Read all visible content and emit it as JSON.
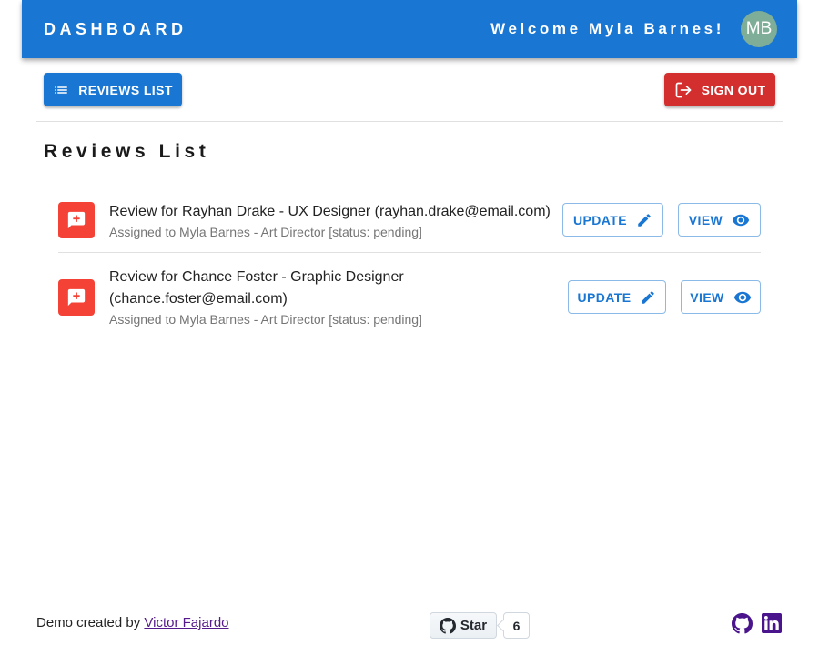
{
  "header": {
    "title": "DASHBOARD",
    "welcome": "Welcome Myla Barnes!",
    "avatar_initials": "MB",
    "color": "#1976d2"
  },
  "toolbar": {
    "reviews_list_label": "REVIEWS LIST",
    "sign_out_label": "SIGN OUT"
  },
  "main": {
    "title": "Reviews List",
    "reviews": [
      {
        "primary": "Review for Rayhan Drake - UX Designer (rayhan.drake@email.com)",
        "secondary": "Assigned to Myla Barnes - Art Director [status: pending]",
        "update_label": "UPDATE",
        "view_label": "VIEW"
      },
      {
        "primary": "Review for Chance Foster - Graphic Designer (chance.foster@email.com)",
        "secondary": "Assigned to Myla Barnes - Art Director [status: pending]",
        "update_label": "UPDATE",
        "view_label": "VIEW"
      }
    ]
  },
  "footer": {
    "credit_prefix": "Demo created by",
    "credit_link": "Victor Fajardo",
    "star_label": "Star",
    "star_count": "6"
  },
  "icons": {
    "list": "list-icon",
    "logout": "logout-icon",
    "review": "rate-review-icon",
    "edit": "pencil-icon",
    "view": "eye-icon",
    "github": "github-icon",
    "linkedin": "linkedin-icon"
  },
  "colors": {
    "primary": "#1976d2",
    "danger": "#d32f2f",
    "review_icon": "#f44336",
    "avatar": "#7fae98",
    "link": "#551a8b"
  }
}
